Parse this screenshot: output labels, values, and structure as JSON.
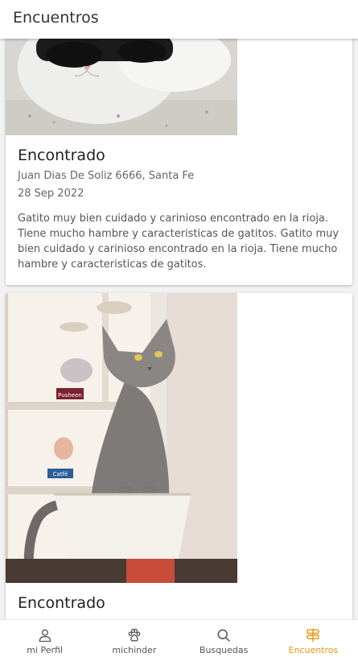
{
  "appbar": {
    "title": "Encuentros"
  },
  "cards": [
    {
      "title": "Encontrado",
      "address": "Juan Dias De Soliz 6666, Santa Fe",
      "date": "28 Sep 2022",
      "description": "Gatito muy bien cuidado y carinioso encontrado en la rioja. Tiene mucho hambre y caracteristicas de gatitos. Gatito muy bien cuidado y carinioso encontrado en la rioja. Tiene mucho hambre y caracteristicas de gatitos."
    },
    {
      "title": "Encontrado",
      "photo_labels": [
        "Pusheen",
        "Catfé"
      ]
    }
  ],
  "nav": {
    "items": [
      {
        "label": "mi Perfil",
        "icon": "person-icon"
      },
      {
        "label": "michinder",
        "icon": "paw-icon"
      },
      {
        "label": "Busquedas",
        "icon": "search-icon"
      },
      {
        "label": "Encuentros",
        "icon": "signpost-icon",
        "active": true
      }
    ],
    "active_color": "#e8950f"
  }
}
